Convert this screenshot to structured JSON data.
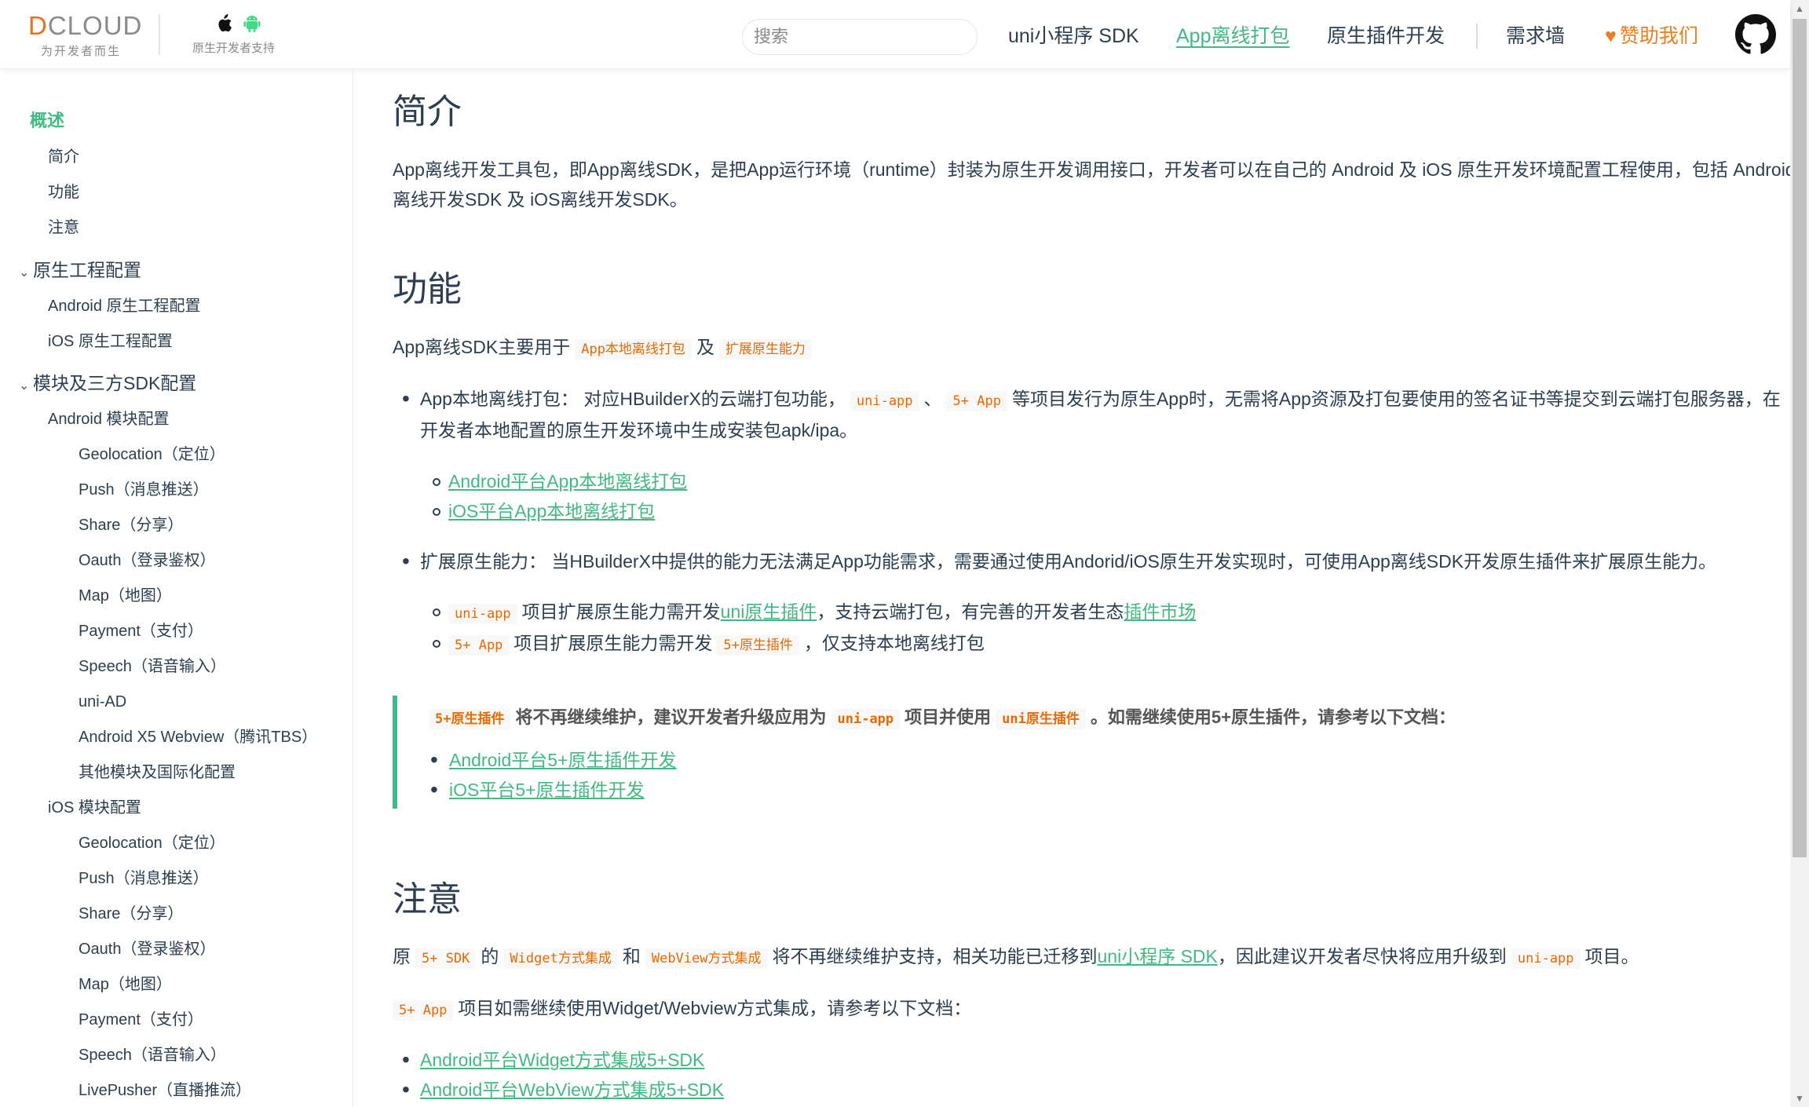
{
  "brand": {
    "logo_text": "DCLOUD",
    "logo_sub": "为开发者而生",
    "native_sub": "原生开发者支持"
  },
  "nav": {
    "search_placeholder": "搜索",
    "links": [
      "uni小程序 SDK",
      "App离线打包",
      "原生插件开发",
      "需求墙",
      "赞助我们"
    ],
    "active": "App离线打包"
  },
  "sidebar": {
    "overview": "概述",
    "overview_items": [
      "简介",
      "功能",
      "注意"
    ],
    "group1": "原生工程配置",
    "group1_items": [
      "Android 原生工程配置",
      "iOS 原生工程配置"
    ],
    "group2": "模块及三方SDK配置",
    "android_modules": "Android 模块配置",
    "android_items": [
      "Geolocation（定位）",
      "Push（消息推送）",
      "Share（分享）",
      "Oauth（登录鉴权）",
      "Map（地图）",
      "Payment（支付）",
      "Speech（语音输入）",
      "uni-AD",
      "Android X5 Webview（腾讯TBS）",
      "其他模块及国际化配置"
    ],
    "ios_modules": "iOS 模块配置",
    "ios_items": [
      "Geolocation（定位）",
      "Push（消息推送）",
      "Share（分享）",
      "Oauth（登录鉴权）",
      "Map（地图）",
      "Payment（支付）",
      "Speech（语音输入）",
      "LivePusher（直播推流）"
    ]
  },
  "content": {
    "intro_title": "简介",
    "intro_line1": "App离线开发工具包，即App离线SDK，是把App运行环境（runtime）封装为原生开发调用接口，开发者可以在自己的 Android 及 iOS 原生开发环境配置工程使用，包括 Android",
    "intro_line2": "离线开发SDK 及 iOS离线开发SDK。",
    "func_title": "功能",
    "func_lead": "App离线SDK主要用于",
    "func_code1": "App本地离线打包",
    "func_and": "及",
    "func_code2": "扩展原生能力",
    "b1_label": "App本地离线打包：",
    "b1_text1": "对应HBuilderX的云端打包功能，",
    "b1_code1": "uni-app",
    "b1_sep": "、",
    "b1_code2": "5+ App",
    "b1_text2": "等项目发行为原生App时，无需将App资源及打包要使用的签名证书等提交到云端打包服务器，在",
    "b1_line2": "开发者本地配置的原生开发环境中生成安装包apk/ipa。",
    "b1_links": [
      "Android平台App本地离线打包",
      "iOS平台App本地离线打包"
    ],
    "b2_label": "扩展原生能力：",
    "b2_text": "当HBuilderX中提供的能力无法满足App功能需求，需要通过使用Andorid/iOS原生开发实现时，可使用App离线SDK开发原生插件来扩展原生能力。",
    "s1_code": "uni-app",
    "s1_text1": "项目扩展原生能力需开发",
    "s1_link1": "uni原生插件",
    "s1_text2": "，支持云端打包，有完善的开发者生态",
    "s1_link2": "插件市场",
    "s2_code1": "5+ App",
    "s2_text1": "项目扩展原生能力需开发",
    "s2_code2": "5+原生插件",
    "s2_text2": "，仅支持本地离线打包",
    "tip_code1": "5+原生插件",
    "tip_text1": "将不再继续维护，建议开发者升级应用为",
    "tip_code2": "uni-app",
    "tip_text2": "项目并使用",
    "tip_code3": "uni原生插件",
    "tip_text3": "。如需继续使用5+原生插件，请参考以下文档：",
    "tip_links": [
      "Android平台5+原生插件开发",
      "iOS平台5+原生插件开发"
    ],
    "note_title": "注意",
    "n1_text1": "原",
    "n1_code1": "5+ SDK",
    "n1_text2": "的",
    "n1_code2": "Widget方式集成",
    "n1_text3": "和",
    "n1_code3": "WebView方式集成",
    "n1_text4": "将不再继续维护支持，相关功能已迁移到",
    "n1_link": "uni小程序 SDK",
    "n1_text5": "，因此建议开发者尽快将应用升级到",
    "n1_code4": "uni-app",
    "n1_text6": "项目。",
    "n2_code": "5+ App",
    "n2_text": "项目如需继续使用Widget/Webview方式集成，请参考以下文档：",
    "n_links": [
      "Android平台Widget方式集成5+SDK",
      "Android平台WebView方式集成5+SDK"
    ]
  }
}
